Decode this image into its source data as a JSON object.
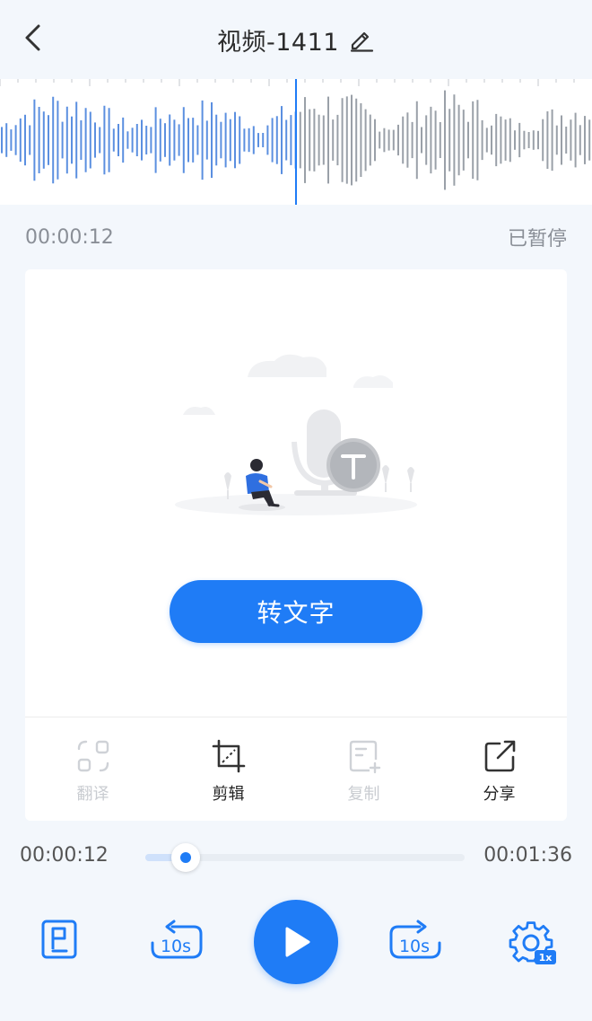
{
  "header": {
    "title": "视频-1411",
    "back_icon": "chevron-left-icon",
    "edit_icon": "pencil-icon"
  },
  "status": {
    "elapsed": "00:00:12",
    "state": "已暂停"
  },
  "card": {
    "illustration": "empty-transcript-illustration",
    "convert_label": "转文字",
    "actions": [
      {
        "label": "翻译",
        "icon": "translate-icon",
        "enabled": false
      },
      {
        "label": "剪辑",
        "icon": "crop-icon",
        "enabled": true
      },
      {
        "label": "复制",
        "icon": "copy-icon",
        "enabled": false
      },
      {
        "label": "分享",
        "icon": "share-icon",
        "enabled": true
      }
    ]
  },
  "player": {
    "current_time": "00:00:12",
    "total_time": "00:01:36",
    "progress_fraction": 0.125,
    "speed_badge": "1x",
    "rewind_label": "10s",
    "forward_label": "10s"
  },
  "colors": {
    "accent": "#1f7cf6",
    "played_wave": "#5b8fe0",
    "unplayed_wave": "#9aa0a8",
    "background": "#f3f7fc"
  }
}
